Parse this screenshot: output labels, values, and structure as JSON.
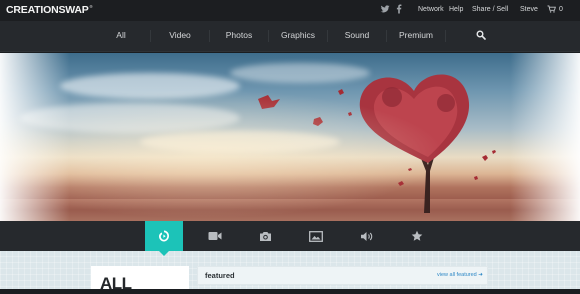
{
  "brand": {
    "logo_text": "CREATIONSWAP",
    "logo_mark": "®"
  },
  "topbar": {
    "social_icons": [
      "twitter-icon",
      "facebook-icon"
    ],
    "links": [
      "Network",
      "Help",
      "Share / Sell",
      "Steve"
    ],
    "cart_count": "0"
  },
  "nav": {
    "items": [
      "All",
      "Video",
      "Photos",
      "Graphics",
      "Sound",
      "Premium"
    ],
    "search_icon": "search-icon"
  },
  "categories": {
    "icons": [
      "all-icon",
      "video-icon",
      "camera-icon",
      "image-icon",
      "sound-icon",
      "star-icon"
    ],
    "active_index": 0
  },
  "content": {
    "side_title": "ALL",
    "featured_title": "featured",
    "view_all_label": "view all featured ➜"
  },
  "colors": {
    "accent": "#1cc3b8",
    "nav_bg": "#26292d",
    "top_bg": "#1c1e21",
    "link": "#2e88c6",
    "content_bg": "#dbe6ea"
  }
}
